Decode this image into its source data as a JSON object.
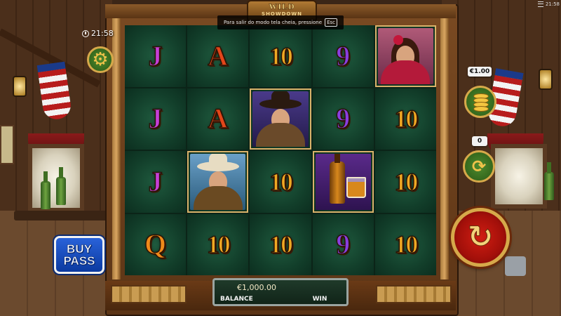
{
  "game": {
    "logo_title": "WILD",
    "logo_subtitle": "SHOWDOWN"
  },
  "notification": {
    "text": "Para salir do modo tela cheia, pressione",
    "key": "Esc"
  },
  "status": {
    "clock": "21:58",
    "device_time": "21:58"
  },
  "controls": {
    "bet_value": "€1.00",
    "autoplay_count": "0",
    "buy_label_1": "BUY",
    "buy_label_2": "PASS",
    "settings_icon": "gear-icon",
    "bet_icon": "coins-icon",
    "autoplay_icon": "autoplay-icon",
    "spin_icon": "spin-icon"
  },
  "footer": {
    "balance_value": "€1,000.00",
    "balance_label": "BALANCE",
    "win_label": "WIN"
  },
  "reels": [
    [
      {
        "type": "text",
        "value": "J",
        "color": "#c53fd8",
        "kind": "j"
      },
      {
        "type": "text",
        "value": "A",
        "color": "#e2461a",
        "kind": "a"
      },
      {
        "type": "text",
        "value": "10",
        "color": "#f0a823",
        "kind": "ten"
      },
      {
        "type": "text",
        "value": "9",
        "color": "#8a3ee0",
        "kind": "nine"
      },
      {
        "type": "picture",
        "symbol": "saloon-girl"
      }
    ],
    [
      {
        "type": "text",
        "value": "J",
        "color": "#c53fd8",
        "kind": "j"
      },
      {
        "type": "text",
        "value": "A",
        "color": "#e2461a",
        "kind": "a"
      },
      {
        "type": "picture",
        "symbol": "gunslinger"
      },
      {
        "type": "text",
        "value": "9",
        "color": "#8a3ee0",
        "kind": "nine"
      },
      {
        "type": "text",
        "value": "10",
        "color": "#f0a823",
        "kind": "ten"
      }
    ],
    [
      {
        "type": "text",
        "value": "J",
        "color": "#c53fd8",
        "kind": "j"
      },
      {
        "type": "picture",
        "symbol": "sheriff"
      },
      {
        "type": "text",
        "value": "10",
        "color": "#f0a823",
        "kind": "ten"
      },
      {
        "type": "picture",
        "symbol": "whiskey"
      },
      {
        "type": "text",
        "value": "10",
        "color": "#f0a823",
        "kind": "ten"
      }
    ],
    [
      {
        "type": "text",
        "value": "Q",
        "color": "#f08a1a",
        "kind": "q"
      },
      {
        "type": "text",
        "value": "10",
        "color": "#f0a823",
        "kind": "ten"
      },
      {
        "type": "text",
        "value": "10",
        "color": "#f0a823",
        "kind": "ten"
      },
      {
        "type": "text",
        "value": "9",
        "color": "#8a3ee0",
        "kind": "nine"
      },
      {
        "type": "text",
        "value": "10",
        "color": "#f0a823",
        "kind": "ten"
      }
    ]
  ]
}
